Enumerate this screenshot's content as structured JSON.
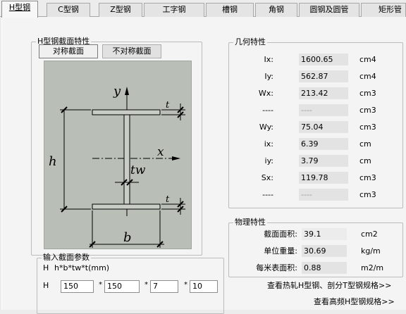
{
  "tabs": [
    {
      "label": "H型钢",
      "active": true
    },
    {
      "label": "C型钢"
    },
    {
      "label": "Z型钢"
    },
    {
      "label": "工字钢"
    },
    {
      "label": "槽钢"
    },
    {
      "label": "角钢"
    },
    {
      "label": "圆钢及圆管"
    },
    {
      "label": "矩形管"
    }
  ],
  "section_group": {
    "title": "H型钢截面特性",
    "btn_symmetric": "对称截面",
    "btn_asymmetric": "不对称截面"
  },
  "diagram": {
    "label_y": "y",
    "label_x": "x",
    "label_h": "h",
    "label_b": "b",
    "label_tw": "tw",
    "label_t_top": "t",
    "label_t_bottom": "t"
  },
  "input_group": {
    "title": "输入截面参数",
    "formula_prefix": "H",
    "formula": "h*b*tw*t(mm)",
    "row_prefix": "H",
    "h": "150",
    "b": "150",
    "tw": "7",
    "t": "10",
    "sep": "*"
  },
  "geometry": {
    "title": "几何特性",
    "rows": [
      {
        "label": "Ix:",
        "value": "1600.65",
        "unit": "cm4"
      },
      {
        "label": "Iy:",
        "value": "562.87",
        "unit": "cm4"
      },
      {
        "label": "Wx:",
        "value": "213.42",
        "unit": "cm3"
      },
      {
        "label": "----",
        "value": "----",
        "unit": "cm3"
      },
      {
        "label": "Wy:",
        "value": "75.04",
        "unit": "cm3"
      },
      {
        "label": "ix:",
        "value": "6.39",
        "unit": "cm"
      },
      {
        "label": "iy:",
        "value": "3.79",
        "unit": "cm"
      },
      {
        "label": "Sx:",
        "value": "119.78",
        "unit": "cm3"
      },
      {
        "label": "----",
        "value": "----",
        "unit": "cm3"
      }
    ]
  },
  "physical": {
    "title": "物理特性",
    "rows": [
      {
        "label": "截面面积:",
        "value": "39.1",
        "unit": "cm2"
      },
      {
        "label": "单位重量:",
        "value": "30.69",
        "unit": "kg/m"
      },
      {
        "label": "每米表面积:",
        "value": "0.88",
        "unit": "m2/m"
      }
    ]
  },
  "links": {
    "hot_rolled": "查看热轧H型钢、剖分T型钢规格>>",
    "high_freq": "查看高频H型钢规格>>"
  },
  "colors": {
    "diagram_bg": "#b9bfb6",
    "value_bg": "#e3e3e3"
  }
}
